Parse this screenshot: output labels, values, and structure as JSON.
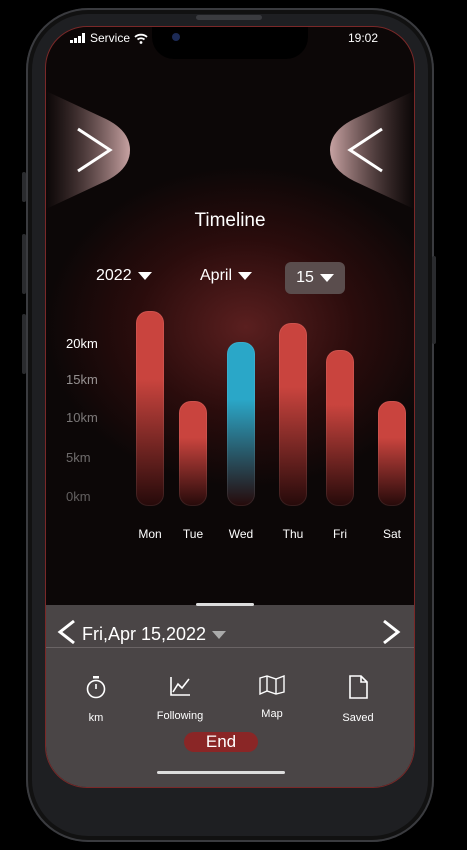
{
  "status": {
    "carrier": "Service",
    "time": "19:02"
  },
  "title": "Timeline",
  "filters": {
    "year": "2022",
    "month": "April",
    "day": "15"
  },
  "chart_data": {
    "type": "bar",
    "categories": [
      "Mon",
      "Tue",
      "Wed",
      "Thu",
      "Fri",
      "Sat"
    ],
    "values": [
      25,
      13.5,
      21,
      23.5,
      20,
      13.5
    ],
    "highlight_index": 2,
    "yticks": [
      "20km",
      "15km",
      "10km",
      "5km",
      "0km"
    ],
    "ylim": [
      0,
      25
    ],
    "colors": {
      "bar": "#c9443e",
      "highlight": "#2aa7c8"
    }
  },
  "date_nav": {
    "date": "Fri,Apr 15,2022"
  },
  "toolbar": {
    "items": [
      {
        "icon": "stopwatch-icon",
        "label": "km"
      },
      {
        "icon": "chart-line-icon",
        "label": "Following"
      },
      {
        "icon": "map-icon",
        "label": "Map"
      },
      {
        "icon": "document-icon",
        "label": "Saved"
      }
    ],
    "end_label": "End"
  }
}
